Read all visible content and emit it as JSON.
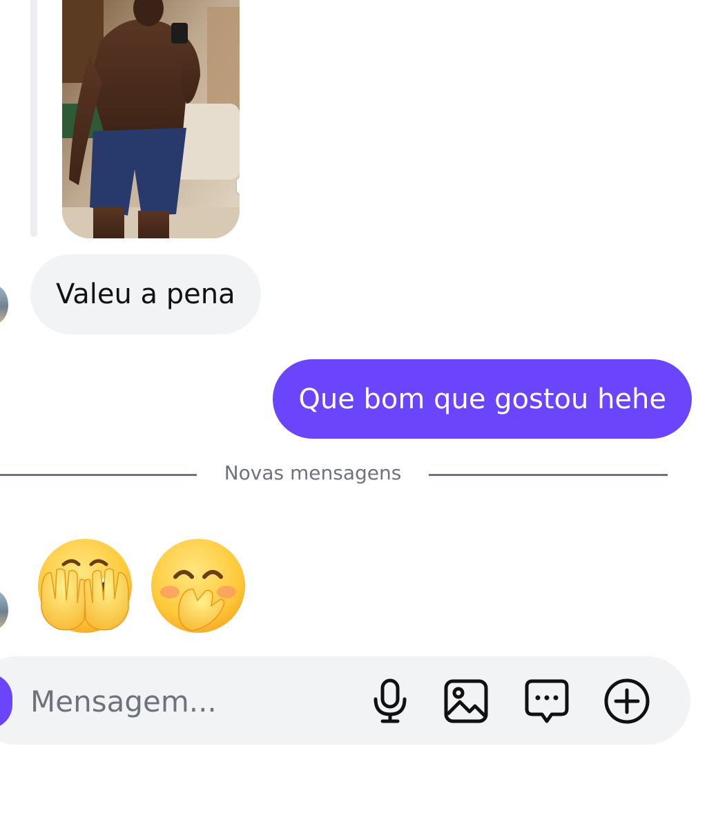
{
  "conversation": {
    "story_sticker": "🔗😏💦",
    "messages": [
      {
        "direction": "incoming",
        "text": "Valeu a pena"
      },
      {
        "direction": "outgoing",
        "text": "Que bom que gostou hehe"
      }
    ],
    "divider_label": "Novas mensagens",
    "emoji_message": [
      "🫣",
      "🤭"
    ]
  },
  "composer": {
    "placeholder": "Mensagem...",
    "icons": [
      "camera-icon",
      "microphone-icon",
      "gallery-icon",
      "sticker-icon",
      "plus-icon"
    ]
  },
  "colors": {
    "accent": "#6b45fb",
    "incoming_bubble": "#f2f3f5",
    "muted_text": "#6e727a"
  }
}
